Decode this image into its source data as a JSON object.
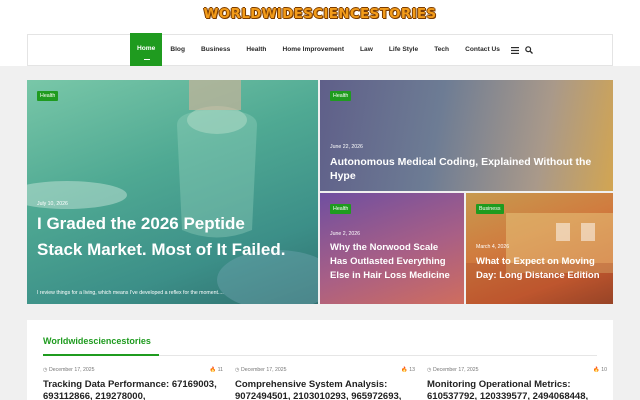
{
  "site": {
    "logo": "WORLDWIDESCIENCESTORIES"
  },
  "nav": {
    "items": [
      "Home",
      "Blog",
      "Business",
      "Health",
      "Home Improvement",
      "Law",
      "Life Style",
      "Tech",
      "Contact Us"
    ],
    "icons": [
      "menu-icon",
      "search-icon"
    ]
  },
  "hero": {
    "main": {
      "category": "Health",
      "date": "July 10, 2026",
      "title": "I Graded the 2026 Peptide Stack Market. Most of It Failed.",
      "excerpt": "I review things for a living, which means I've developed a reflex for the moment...."
    },
    "top_right": {
      "category": "Health",
      "date": "June 22, 2026",
      "title": "Autonomous Medical Coding, Explained Without the Hype"
    },
    "bottom_left": {
      "category": "Health",
      "date": "June 2, 2026",
      "title": "Why the Norwood Scale Has Outlasted Everything Else in Hair Loss Medicine"
    },
    "bottom_right": {
      "category": "Business",
      "date": "March 4, 2026",
      "title": "What to Expect on Moving Day: Long Distance Edition"
    }
  },
  "section": {
    "title": "Worldwidesciencestories",
    "posts": [
      {
        "date": "December 17, 2025",
        "count": "11",
        "title": "Tracking Data Performance: 67169003, 693112866, 219278000,"
      },
      {
        "date": "December 17, 2025",
        "count": "13",
        "title": "Comprehensive System Analysis: 9072494501, 2103010293, 965972693,"
      },
      {
        "date": "December 17, 2025",
        "count": "10",
        "title": "Monitoring Operational Metrics: 610537792, 120339577, 2494068448,"
      }
    ]
  }
}
